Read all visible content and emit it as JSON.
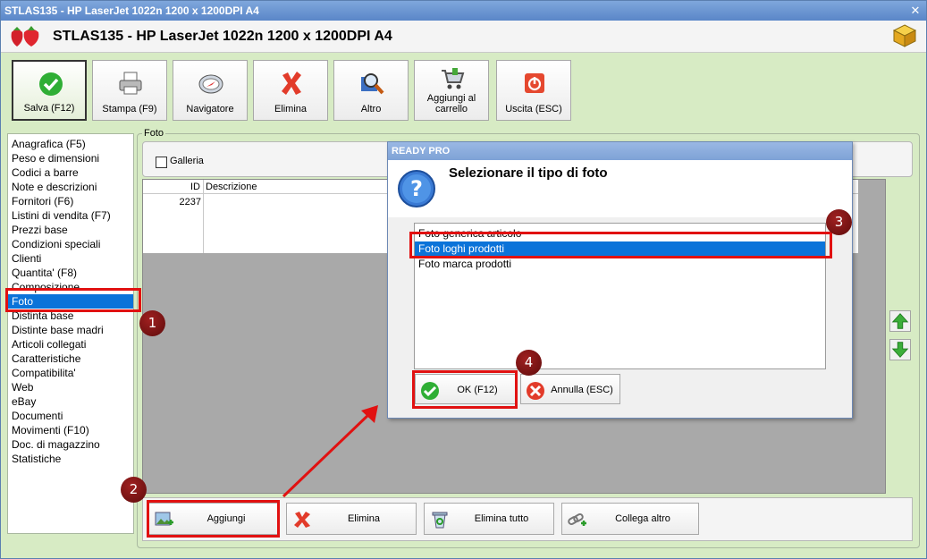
{
  "window": {
    "titlebar_text": "STLAS135 - HP LaserJet 1022n 1200 x 1200DPI A4",
    "header_title": "STLAS135 - HP LaserJet 1022n 1200 x 1200DPI A4",
    "close_glyph": "✕"
  },
  "toolbar": {
    "save": "Salva (F12)",
    "print": "Stampa (F9)",
    "navigator": "Navigatore",
    "delete": "Elimina",
    "other": "Altro",
    "add_to_cart": "Aggiungi al carrello",
    "exit": "Uscita (ESC)"
  },
  "sidebar": {
    "items": [
      "Anagrafica (F5)",
      "Peso e dimensioni",
      "Codici a barre",
      "Note e descrizioni",
      "Fornitori (F6)",
      "Listini di vendita (F7)",
      "Prezzi base",
      "Condizioni speciali",
      "Clienti",
      "Quantita' (F8)",
      "Composizione",
      "Foto",
      "Distinta base",
      "Distinte base madri",
      "Articoli collegati",
      "Caratteristiche",
      "Compatibilita'",
      "Web",
      "eBay",
      "Documenti",
      "Movimenti (F10)",
      "Doc. di magazzino",
      "Statistiche"
    ],
    "selected": "Foto"
  },
  "panel": {
    "legend": "Foto",
    "galleria_label": "Galleria",
    "galleria_checked": false,
    "table": {
      "headers": [
        "ID",
        "Descrizione"
      ],
      "rows": [
        [
          "2237",
          ""
        ]
      ]
    }
  },
  "bottom_bar": {
    "add": "Aggiungi",
    "delete": "Elimina",
    "delete_all": "Elimina tutto",
    "link_other": "Collega altro"
  },
  "dialog": {
    "title": "READY PRO",
    "message": "Selezionare il tipo di foto",
    "options": [
      "Foto generica articolo",
      "Foto loghi prodotti",
      "Foto marca prodotti"
    ],
    "selected": "Foto loghi prodotti",
    "ok": "OK (F12)",
    "cancel": "Annulla (ESC)"
  },
  "annotations": {
    "badges": [
      "1",
      "2",
      "3",
      "4"
    ]
  },
  "colors": {
    "selection_blue": "#0b73d9",
    "annotation_red": "#e11111",
    "background_green": "#d7ebc4",
    "titlebar_blue": "#6a93d0"
  }
}
